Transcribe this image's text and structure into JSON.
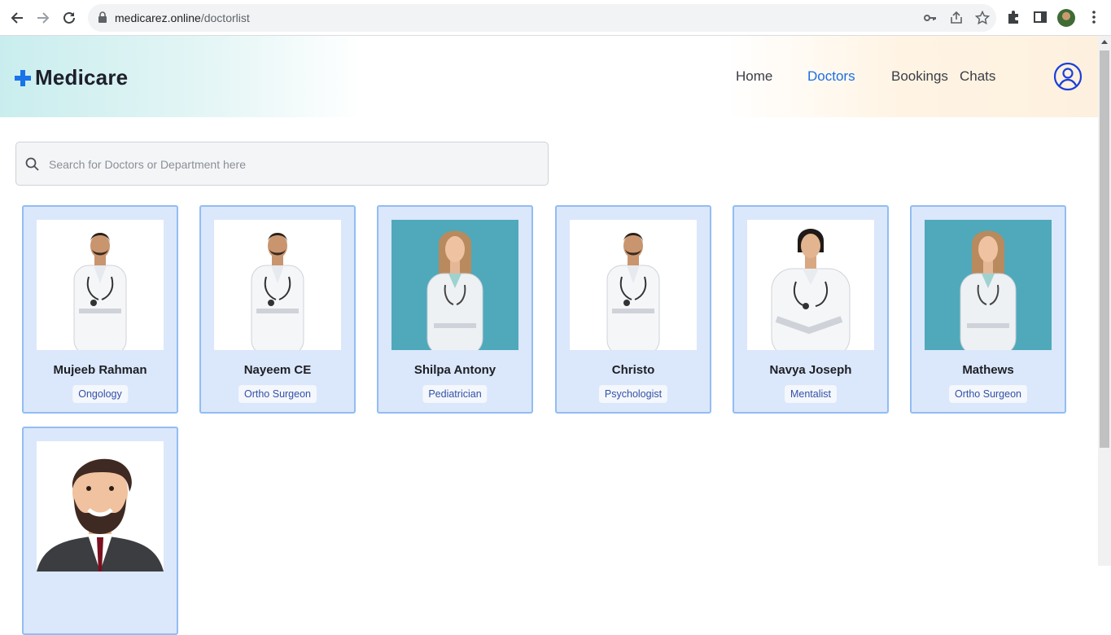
{
  "browser": {
    "url_host": "medicarez.online",
    "url_path": "/doctorlist"
  },
  "site": {
    "brand": "Medicare",
    "nav": [
      {
        "label": "Home",
        "active": false
      },
      {
        "label": "Doctors",
        "active": true
      },
      {
        "label": "Bookings",
        "active": false
      },
      {
        "label": "Chats",
        "active": false
      }
    ]
  },
  "search": {
    "placeholder": "Search for Doctors or Department here",
    "value": ""
  },
  "doctors": [
    {
      "name": "Mujeeb Rahman",
      "department": "Ongology"
    },
    {
      "name": "Nayeem CE",
      "department": "Ortho Surgeon"
    },
    {
      "name": "Shilpa Antony",
      "department": "Pediatrician"
    },
    {
      "name": "Christo",
      "department": "Psychologist"
    },
    {
      "name": "Navya Joseph",
      "department": "Mentalist"
    },
    {
      "name": "Mathews",
      "department": "Ortho Surgeon"
    },
    {
      "name": "",
      "department": ""
    }
  ],
  "colors": {
    "accent": "#1a6ee8",
    "card_bg": "#dbe7fb",
    "card_border": "#92bdf2",
    "badge_text": "#3351a8"
  }
}
